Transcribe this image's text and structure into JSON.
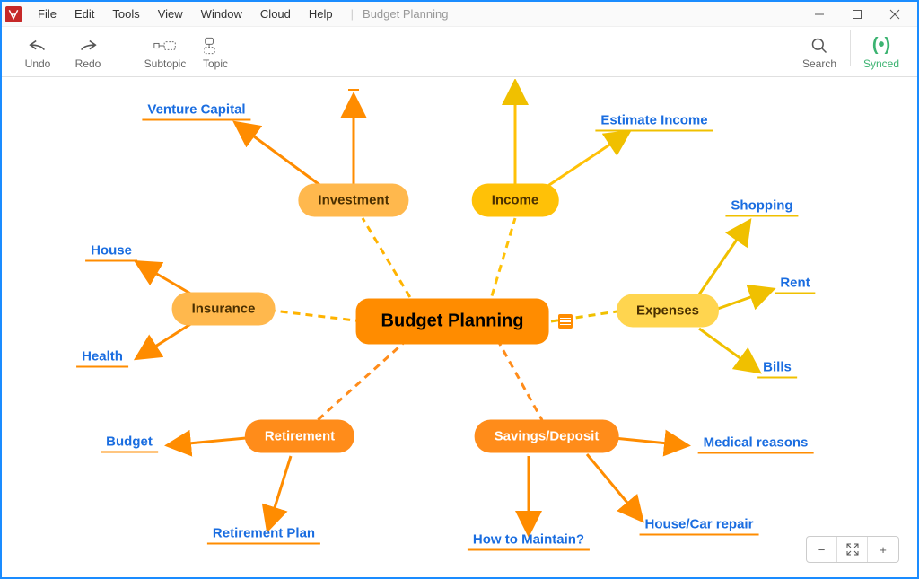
{
  "menu": {
    "file": "File",
    "edit": "Edit",
    "tools": "Tools",
    "view": "View",
    "window": "Window",
    "cloud": "Cloud",
    "help": "Help"
  },
  "doc": {
    "title": "Budget Planning"
  },
  "toolbar": {
    "undo": "Undo",
    "redo": "Redo",
    "subtopic": "Subtopic",
    "topic": "Topic",
    "search": "Search",
    "synced": "Synced"
  },
  "mindmap": {
    "central": "Budget Planning",
    "investment": "Investment",
    "income": "Income",
    "expenses": "Expenses",
    "savings": "Savings/Deposit",
    "retirement": "Retirement",
    "insurance": "Insurance",
    "leaves": {
      "venture_capital": "Venture Capital",
      "estimate_income": "Estimate Income",
      "shopping": "Shopping",
      "rent": "Rent",
      "bills": "Bills",
      "medical": "Medical reasons",
      "house_car": "House/Car repair",
      "how_maintain": "How to Maintain?",
      "retirement_plan": "Retirement Plan",
      "budget": "Budget",
      "house": "House",
      "health": "Health"
    }
  }
}
